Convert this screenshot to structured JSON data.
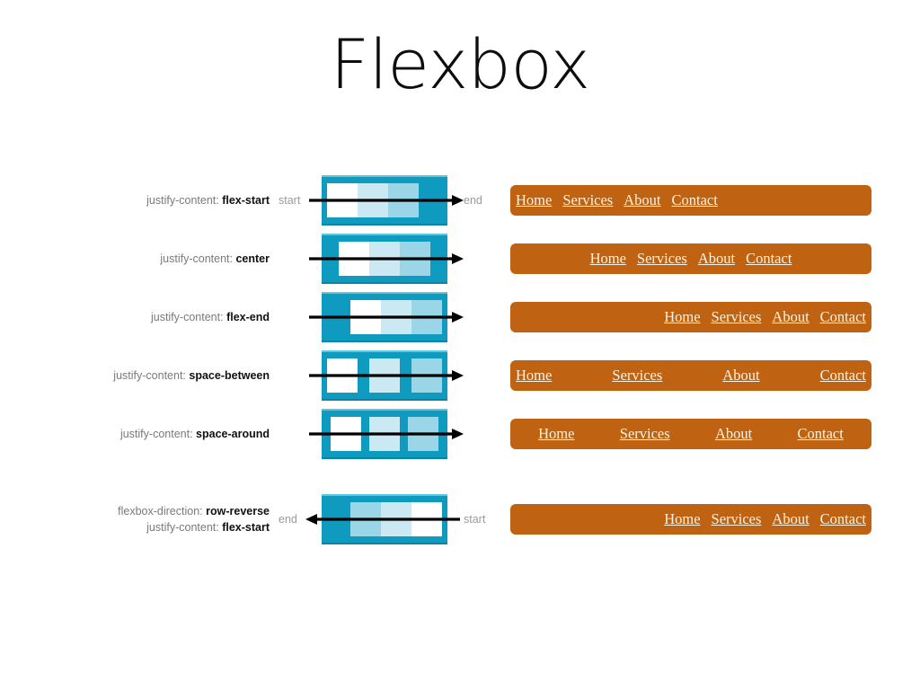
{
  "slide": {
    "title": "Flexbox"
  },
  "colors": {
    "container": "#0f9bc0",
    "container_top_edge": "#5ec7e0",
    "item_1": "#ffffff",
    "item_2": "#cbe9f3",
    "item_3": "#9bd6e8",
    "navbar": "#bf6211",
    "nav_text": "#fdf3e3",
    "label_property": "#7a7a7a",
    "label_value": "#111111",
    "axis_caption": "#9a9a9a",
    "arrow": "#000000"
  },
  "nav_links": [
    "Home",
    "Services",
    "About",
    "Contact"
  ],
  "rows": [
    {
      "label_lines": [
        {
          "property": "justify-content:",
          "value": "flex-start"
        }
      ],
      "axis_start_caption": "start",
      "axis_end_caption": "end",
      "arrow_direction": "right",
      "justify": "flex-start",
      "item_colors": [
        "item_1",
        "item_2",
        "item_3"
      ],
      "nav_order": [
        "Home",
        "Services",
        "About",
        "Contact"
      ]
    },
    {
      "label_lines": [
        {
          "property": "justify-content:",
          "value": "center"
        }
      ],
      "axis_start_caption": "",
      "axis_end_caption": "",
      "arrow_direction": "right",
      "justify": "center",
      "item_colors": [
        "item_1",
        "item_2",
        "item_3"
      ],
      "nav_order": [
        "Home",
        "Services",
        "About",
        "Contact"
      ]
    },
    {
      "label_lines": [
        {
          "property": "justify-content:",
          "value": "flex-end"
        }
      ],
      "axis_start_caption": "",
      "axis_end_caption": "",
      "arrow_direction": "right",
      "justify": "flex-end",
      "item_colors": [
        "item_1",
        "item_2",
        "item_3"
      ],
      "nav_order": [
        "Home",
        "Services",
        "About",
        "Contact"
      ]
    },
    {
      "label_lines": [
        {
          "property": "justify-content:",
          "value": "space-between"
        }
      ],
      "axis_start_caption": "",
      "axis_end_caption": "",
      "arrow_direction": "right",
      "justify": "space-between",
      "item_colors": [
        "item_1",
        "item_2",
        "item_3"
      ],
      "nav_order": [
        "Home",
        "Services",
        "About",
        "Contact"
      ]
    },
    {
      "label_lines": [
        {
          "property": "justify-content:",
          "value": "space-around"
        }
      ],
      "axis_start_caption": "",
      "axis_end_caption": "",
      "arrow_direction": "right",
      "justify": "space-around",
      "item_colors": [
        "item_1",
        "item_2",
        "item_3"
      ],
      "nav_order": [
        "Home",
        "Services",
        "About",
        "Contact"
      ]
    },
    {
      "label_lines": [
        {
          "property": "flexbox-direction:",
          "value": "row-reverse"
        },
        {
          "property": "justify-content:",
          "value": "flex-start"
        }
      ],
      "axis_start_caption": "end",
      "axis_end_caption": "start",
      "arrow_direction": "left",
      "justify": "flex-end",
      "item_colors": [
        "item_3",
        "item_2",
        "item_1"
      ],
      "nav_order": [
        "Home",
        "Services",
        "About",
        "Contact"
      ]
    }
  ]
}
